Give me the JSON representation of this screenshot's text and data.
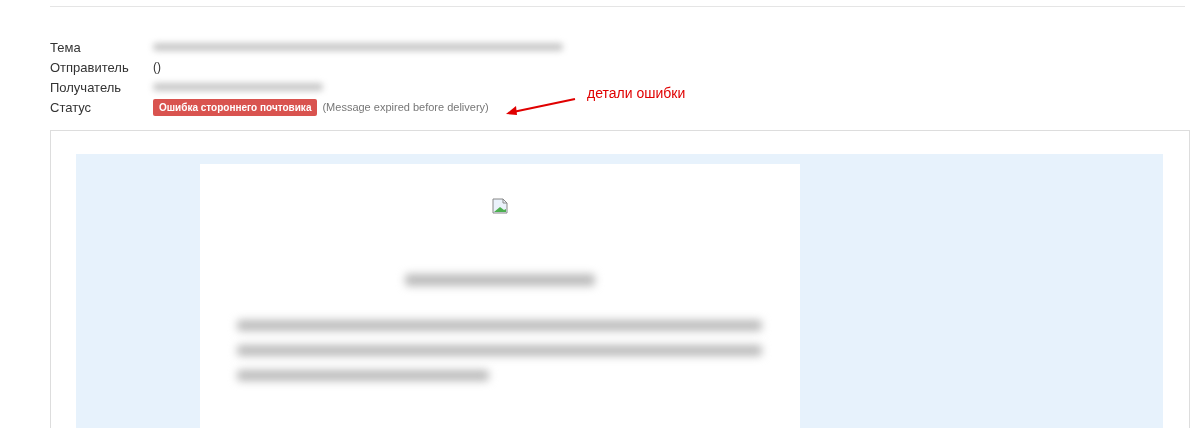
{
  "fields": [
    {
      "label": "Тема",
      "kind": "redacted"
    },
    {
      "label": "Отправитель",
      "kind": "text",
      "value": "()"
    },
    {
      "label": "Получатель",
      "kind": "redacted"
    },
    {
      "label": "Статус",
      "kind": "status",
      "badge": "Ошибка стороннего почтовика",
      "detail": "(Message expired before delivery)"
    }
  ],
  "annotation": {
    "text": "детали ошибки"
  },
  "preview": {
    "kind": "email"
  }
}
